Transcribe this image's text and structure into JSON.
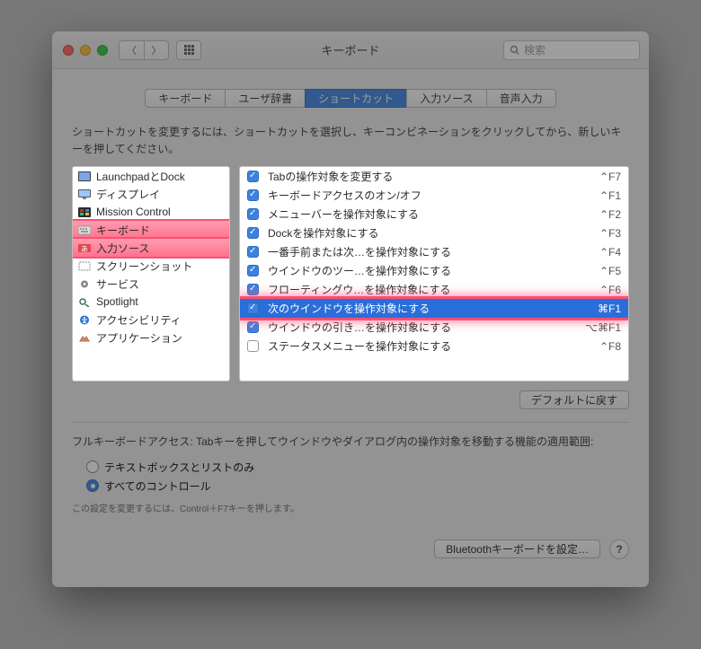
{
  "window": {
    "title": "キーボード",
    "search_placeholder": "検索"
  },
  "tabs": [
    {
      "label": "キーボード"
    },
    {
      "label": "ユーザ辞書"
    },
    {
      "label": "ショートカット",
      "selected": true
    },
    {
      "label": "入力ソース"
    },
    {
      "label": "音声入力"
    }
  ],
  "hint": "ショートカットを変更するには、ショートカットを選択し、キーコンビネーションをクリックしてから、新しいキーを押してください。",
  "left": [
    {
      "icon": "launchpad",
      "label": "LaunchpadとDock"
    },
    {
      "icon": "display",
      "label": "ディスプレイ"
    },
    {
      "icon": "mission",
      "label": "Mission Control"
    },
    {
      "icon": "keyboard",
      "label": "キーボード",
      "highlight": true
    },
    {
      "icon": "input",
      "label": "入力ソース",
      "highlight": true
    },
    {
      "icon": "screenshot",
      "label": "スクリーンショット"
    },
    {
      "icon": "services",
      "label": "サービス"
    },
    {
      "icon": "spotlight",
      "label": "Spotlight"
    },
    {
      "icon": "accessibility",
      "label": "アクセシビリティ"
    },
    {
      "icon": "app",
      "label": "アプリケーション"
    }
  ],
  "right": [
    {
      "checked": true,
      "label": "Tabの操作対象を変更する",
      "shortcut": "⌃F7"
    },
    {
      "checked": true,
      "label": "キーボードアクセスのオン/オフ",
      "shortcut": "⌃F1"
    },
    {
      "checked": true,
      "label": "メニューバーを操作対象にする",
      "shortcut": "⌃F2"
    },
    {
      "checked": true,
      "label": "Dockを操作対象にする",
      "shortcut": "⌃F3"
    },
    {
      "checked": true,
      "label": "一番手前または次…を操作対象にする",
      "shortcut": "⌃F4"
    },
    {
      "checked": true,
      "label": "ウインドウのツー…を操作対象にする",
      "shortcut": "⌃F5"
    },
    {
      "checked": true,
      "label": "フローティングウ…を操作対象にする",
      "shortcut": "⌃F6"
    },
    {
      "checked": true,
      "label": "次のウインドウを操作対象にする",
      "shortcut": "⌘F1",
      "selected": true
    },
    {
      "checked": true,
      "label": "ウインドウの引き…を操作対象にする",
      "shortcut": "⌥⌘F1"
    },
    {
      "checked": false,
      "label": "ステータスメニューを操作対象にする",
      "shortcut": "⌃F8"
    }
  ],
  "reset_label": "デフォルトに戻す",
  "fka": {
    "desc": "フルキーボードアクセス: Tabキーを押してウインドウやダイアログ内の操作対象を移動する機能の適用範囲:",
    "opt1": "テキストボックスとリストのみ",
    "opt2": "すべてのコントロール",
    "footnote": "この設定を変更するには、Control＋F7キーを押します。"
  },
  "footer": {
    "bluetooth": "Bluetoothキーボードを設定…",
    "help": "?"
  }
}
